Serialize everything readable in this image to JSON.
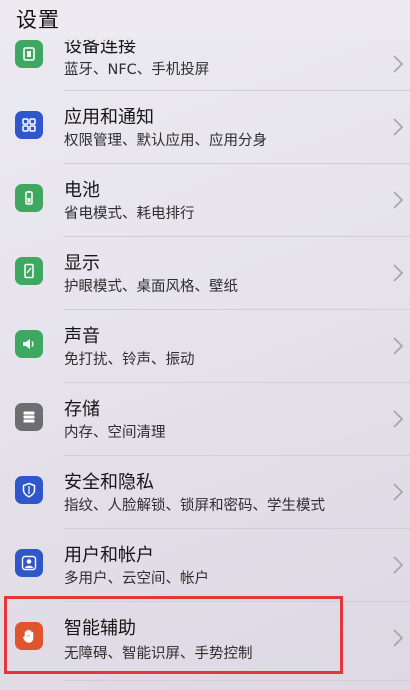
{
  "header": {
    "title": "设置"
  },
  "items": [
    {
      "title": "设备连接",
      "subtitle": "蓝牙、NFC、手机投屏",
      "icon": "device-connection-icon",
      "color": "#3ea860"
    },
    {
      "title": "应用和通知",
      "subtitle": "权限管理、默认应用、应用分身",
      "icon": "apps-grid-icon",
      "color": "#3057c9"
    },
    {
      "title": "电池",
      "subtitle": "省电模式、耗电排行",
      "icon": "battery-icon",
      "color": "#3ea860"
    },
    {
      "title": "显示",
      "subtitle": "护眼模式、桌面风格、壁纸",
      "icon": "display-icon",
      "color": "#3ea860"
    },
    {
      "title": "声音",
      "subtitle": "免打扰、铃声、振动",
      "icon": "speaker-icon",
      "color": "#3ea860"
    },
    {
      "title": "存储",
      "subtitle": "内存、空间清理",
      "icon": "storage-icon",
      "color": "#6e6e72"
    },
    {
      "title": "安全和隐私",
      "subtitle": "指纹、人脸解锁、锁屏和密码、学生模式",
      "icon": "shield-icon",
      "color": "#3057c9"
    },
    {
      "title": "用户和帐户",
      "subtitle": "多用户、云空间、帐户",
      "icon": "user-account-icon",
      "color": "#3057c9"
    },
    {
      "title": "智能辅助",
      "subtitle": "无障碍、智能识屏、手势控制",
      "icon": "hand-gesture-icon",
      "color": "#e0552e"
    }
  ],
  "highlight_color": "#e5373a"
}
